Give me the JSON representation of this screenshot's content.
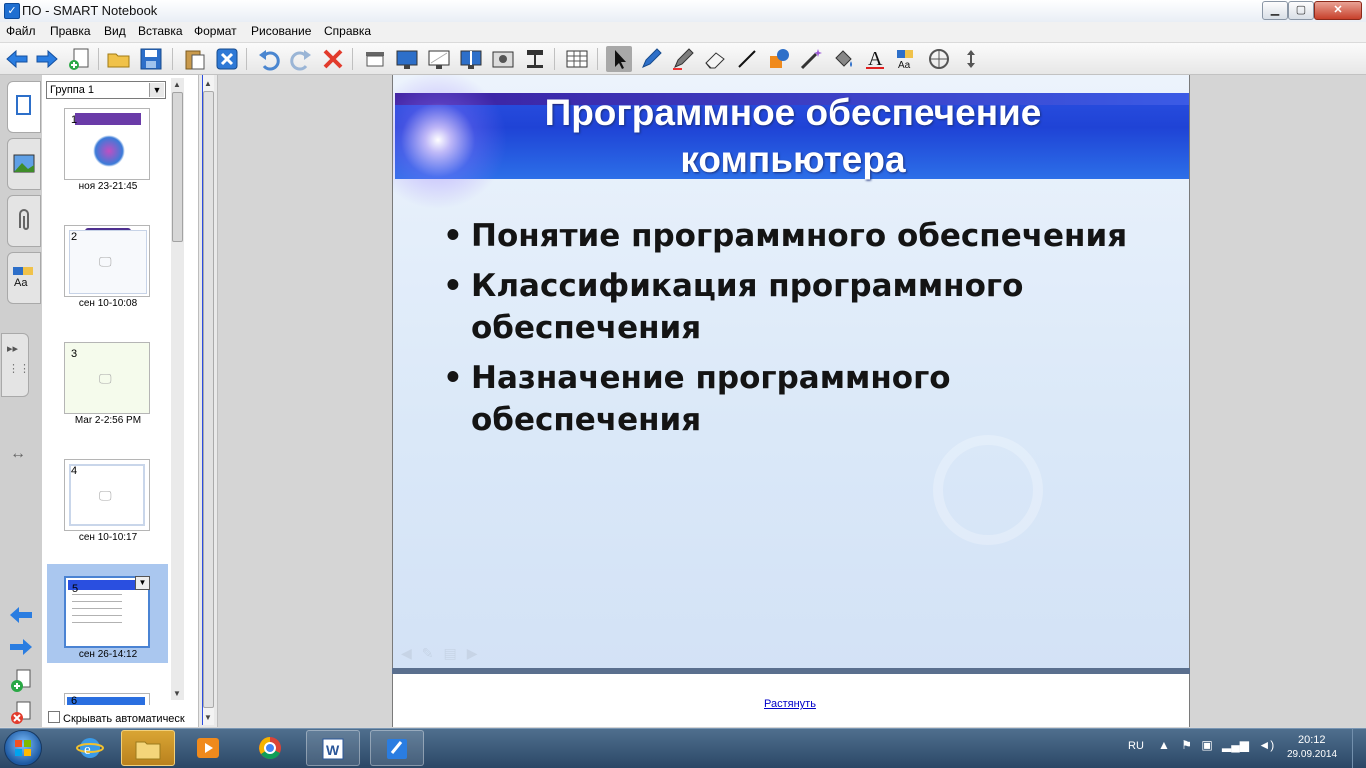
{
  "window": {
    "title": "ПО - SMART Notebook",
    "minimize": "▁",
    "maximize": "▢",
    "close": "✕"
  },
  "menu": [
    "Файл",
    "Правка",
    "Вид",
    "Вставка",
    "Формат",
    "Рисование",
    "Справка"
  ],
  "toolbar": {
    "icons": [
      "back-arrow-icon",
      "forward-arrow-icon",
      "add-page-icon",
      "open-folder-icon",
      "save-icon",
      "paste-icon",
      "delete-page-icon",
      "undo-icon",
      "redo-icon",
      "delete-icon",
      "screen-shade-icon",
      "full-screen-icon",
      "transparent-background-icon",
      "dual-page-icon",
      "screen-capture-icon",
      "document-camera-icon",
      "table-icon",
      "select-icon",
      "pen-icon",
      "creative-pen-icon",
      "eraser-icon",
      "line-icon",
      "shape-icon",
      "magic-pen-icon",
      "fill-icon",
      "text-icon",
      "properties-icon",
      "measurement-tool-icon",
      "toolbar-move-icon"
    ],
    "selected": "select-icon"
  },
  "sidebar": {
    "tabs": [
      "page-sorter-tab",
      "gallery-tab",
      "attachments-tab",
      "properties-tab"
    ]
  },
  "sorter": {
    "group": "Группа 1",
    "pages": [
      {
        "num": "1",
        "date": "ноя 23-21:45"
      },
      {
        "num": "2",
        "date": "сен 10-10:08"
      },
      {
        "num": "3",
        "date": "Mar 2-2:56 PM"
      },
      {
        "num": "4",
        "date": "сен 10-10:17"
      },
      {
        "num": "5",
        "date": "сен 26-14:12",
        "selected": true
      },
      {
        "num": "6",
        "date": ""
      }
    ],
    "auto_hide": "Скрывать автоматическ"
  },
  "slide": {
    "title_line1": "Программное обеспечение",
    "title_line2": "компьютера",
    "bullets": [
      "Понятие программного обеспечения",
      "Классификация программного обеспечения",
      "Назначение программного обеспечения"
    ],
    "stretch_link": "Растянуть"
  },
  "taskbar": {
    "apps": [
      "internet-explorer-icon",
      "file-explorer-icon",
      "media-player-icon",
      "chrome-icon",
      "word-icon",
      "smart-notebook-icon"
    ],
    "language": "RU",
    "time": "20:12",
    "date": "29.09.2014"
  },
  "colors": {
    "title_band": "#2146d8",
    "slide_bg": "#dae8f8",
    "taskbar": "#3a5878"
  }
}
